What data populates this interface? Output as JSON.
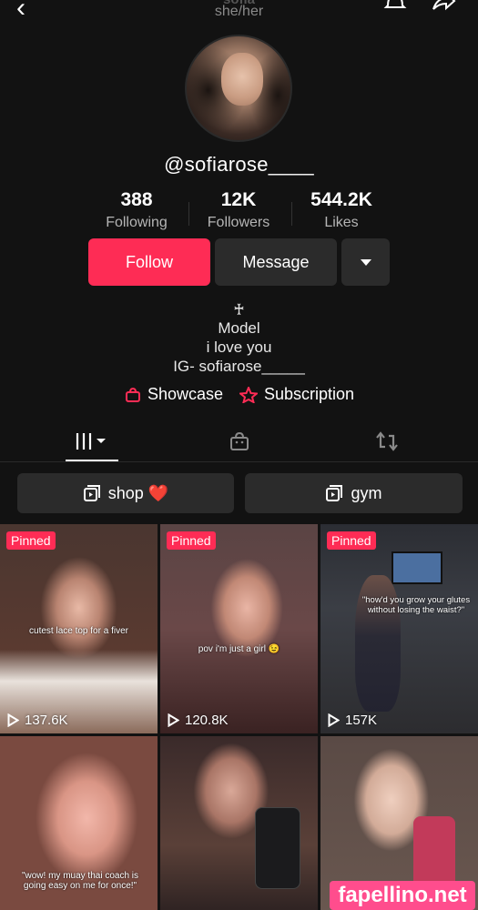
{
  "header": {
    "title": "sofia",
    "pronouns": "she/her"
  },
  "profile": {
    "username": "@sofiarose____",
    "stats": [
      {
        "value": "388",
        "label": "Following"
      },
      {
        "value": "12K",
        "label": "Followers"
      },
      {
        "value": "544.2K",
        "label": "Likes"
      }
    ],
    "buttons": {
      "follow": "Follow",
      "message": "Message"
    },
    "bio": [
      "♰",
      "Model",
      "i love you",
      "IG- sofiarose_____"
    ],
    "links": {
      "showcase": "Showcase",
      "subscription": "Subscription"
    }
  },
  "playlists": [
    {
      "label": "shop ❤️"
    },
    {
      "label": "gym"
    }
  ],
  "videos": [
    {
      "pinned": "Pinned",
      "views": "137.6K",
      "caption": "cutest lace top for a fiver"
    },
    {
      "pinned": "Pinned",
      "views": "120.8K",
      "caption": "pov i'm just a girl 😉"
    },
    {
      "pinned": "Pinned",
      "views": "157K",
      "caption": "\"how'd you grow your glutes without losing the waist?\""
    },
    {
      "caption": "\"wow! my muay thai coach is going easy on me for once!\""
    },
    {
      "caption": ""
    },
    {
      "caption": ""
    }
  ],
  "watermark": "fapellino.net",
  "colors": {
    "accent": "#fe2c55",
    "background": "#121212",
    "button": "#2b2b2b"
  }
}
